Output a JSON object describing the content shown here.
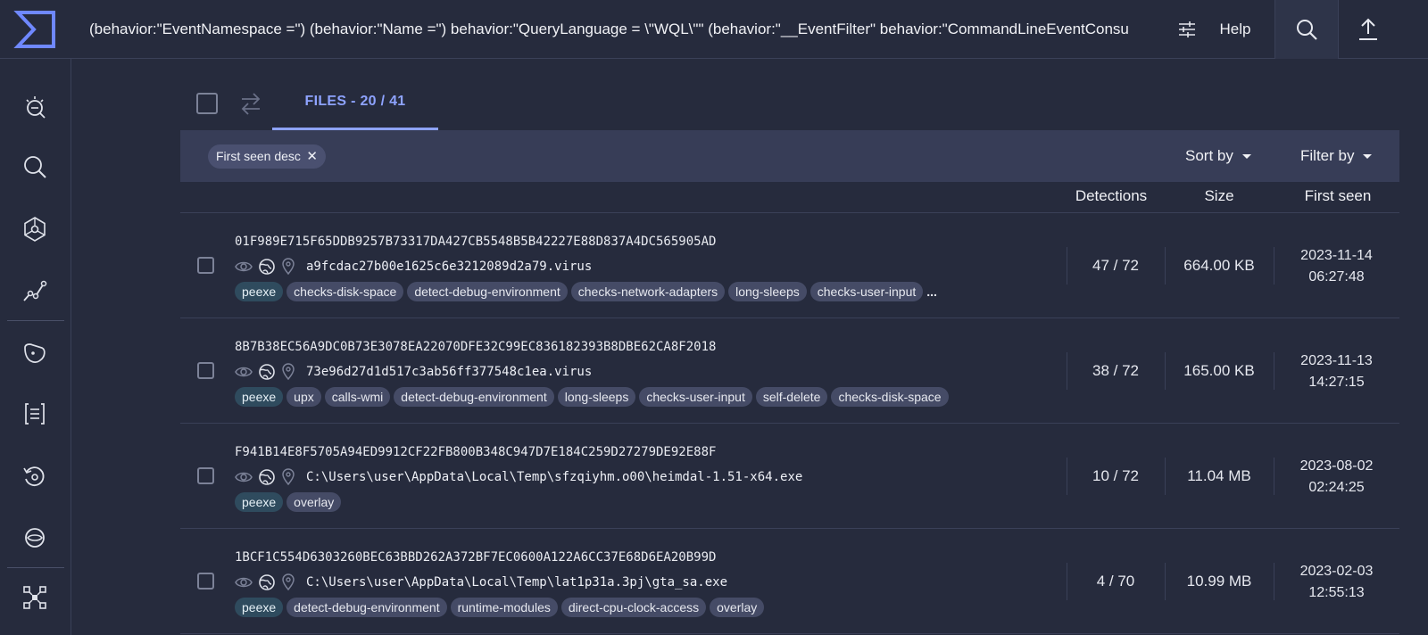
{
  "header": {
    "query": "(behavior:\"EventNamespace =\") (behavior:\"Name =\") behavior:\"QueryLanguage = \\\"WQL\\\"\" (behavior:\"__EventFilter\" behavior:\"CommandLineEventConsu",
    "help_label": "Help"
  },
  "tabs": {
    "files_label": "FILES - 20 / 41"
  },
  "filterbar": {
    "chip_label": "First seen desc",
    "sort_label": "Sort by",
    "filter_label": "Filter by"
  },
  "columns": {
    "detections": "Detections",
    "size": "Size",
    "first_seen": "First seen"
  },
  "rows": [
    {
      "sha256": "01F989E715F65DDB9257B73317DA427CB5548B5B42227E88D837A4DC565905AD",
      "name": "a9fcdac27b00e1625c6e3212089d2a79.virus",
      "tags": [
        "peexe",
        "checks-disk-space",
        "detect-debug-environment",
        "checks-network-adapters",
        "long-sleeps",
        "checks-user-input"
      ],
      "more": "...",
      "detections": "47 / 72",
      "size": "664.00 KB",
      "date": "2023-11-14",
      "time": "06:27:48"
    },
    {
      "sha256": "8B7B38EC56A9DC0B73E3078EA22070DFE32C99EC836182393B8DBE62CA8F2018",
      "name": "73e96d27d1d517c3ab56ff377548c1ea.virus",
      "tags": [
        "peexe",
        "upx",
        "calls-wmi",
        "detect-debug-environment",
        "long-sleeps",
        "checks-user-input",
        "self-delete",
        "checks-disk-space"
      ],
      "more": "",
      "detections": "38 / 72",
      "size": "165.00 KB",
      "date": "2023-11-13",
      "time": "14:27:15"
    },
    {
      "sha256": "F941B14E8F5705A94ED9912CF22FB800B348C947D7E184C259D27279DE92E88F",
      "name": "C:\\Users\\user\\AppData\\Local\\Temp\\sfzqiyhm.o00\\heimdal-1.51-x64.exe",
      "tags": [
        "peexe",
        "overlay"
      ],
      "more": "",
      "detections": "10 / 72",
      "size": "11.04 MB",
      "date": "2023-08-02",
      "time": "02:24:25"
    },
    {
      "sha256": "1BCF1C554D6303260BEC63BBD262A372BF7EC0600A122A6CC37E68D6EA20B99D",
      "name": "C:\\Users\\user\\AppData\\Local\\Temp\\lat1p31a.3pj\\gta_sa.exe",
      "tags": [
        "peexe",
        "detect-debug-environment",
        "runtime-modules",
        "direct-cpu-clock-access",
        "overlay"
      ],
      "more": "",
      "detections": "4 / 70",
      "size": "10.99 MB",
      "date": "2023-02-03",
      "time": "12:55:13"
    }
  ],
  "colors": {
    "accent": "#8ea3ff",
    "background": "#262b3d",
    "filterbar": "#373d57",
    "tag": "#454b66",
    "tag_first": "#2f4b5e"
  }
}
